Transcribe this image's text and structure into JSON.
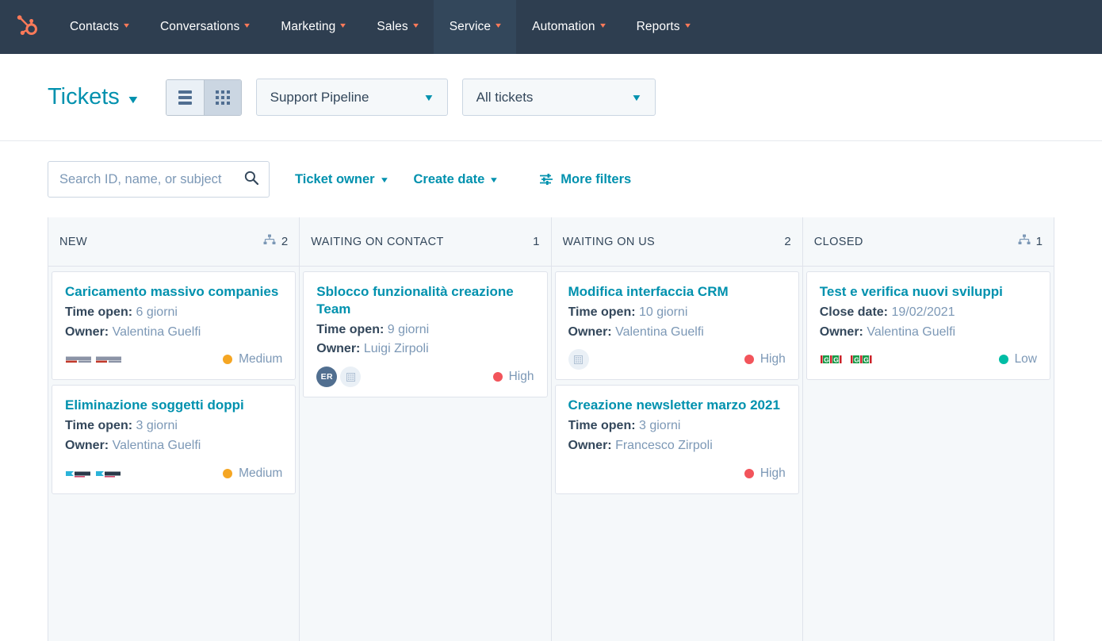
{
  "topnav": {
    "logo_icon": "hubspot-sprocket-logo",
    "items": [
      {
        "label": "Contacts",
        "active": false
      },
      {
        "label": "Conversations",
        "active": false
      },
      {
        "label": "Marketing",
        "active": false
      },
      {
        "label": "Sales",
        "active": false
      },
      {
        "label": "Service",
        "active": true
      },
      {
        "label": "Automation",
        "active": false
      },
      {
        "label": "Reports",
        "active": false
      }
    ]
  },
  "toolbar": {
    "page_title": "Tickets",
    "view_list_icon": "list-view-icon",
    "view_board_icon": "board-view-icon",
    "active_view": "board",
    "pipeline_select": "Support Pipeline",
    "tickets_select": "All tickets"
  },
  "filterbar": {
    "search_placeholder": "Search ID, name, or subject",
    "search_value": "",
    "search_icon": "search-icon",
    "ticket_owner": "Ticket owner",
    "create_date": "Create date",
    "more_filters": "More filters",
    "more_filters_icon": "filter-sliders-icon"
  },
  "colors": {
    "nav_bg": "#2e3e50",
    "nav_active_bg": "#33475b",
    "brand_orange": "#ff7a59",
    "link_teal": "#0091ae",
    "priority_high": "#f2545b",
    "priority_medium": "#f5a623",
    "priority_low": "#00bda5",
    "board_bg": "#f5f8fa",
    "border": "#dfe3eb"
  },
  "board": {
    "columns": [
      {
        "title": "NEW",
        "count": "2",
        "has_workflow_icon": true,
        "workflow_icon": "workflow-icon",
        "cards": [
          {
            "title": "Caricamento massivo companies",
            "meta_label": "Time open:",
            "meta_value": "6 giorni",
            "owner_label": "Owner:",
            "owner_value": "Valentina Guelfi",
            "avatars": [
              {
                "type": "logo",
                "name": "company-logo-avatar"
              },
              {
                "type": "logo",
                "name": "company-logo-avatar"
              }
            ],
            "priority": "Medium",
            "priority_color": "#f5a623"
          },
          {
            "title": "Eliminazione soggetti doppi",
            "meta_label": "Time open:",
            "meta_value": "3 giorni",
            "owner_label": "Owner:",
            "owner_value": "Valentina Guelfi",
            "avatars": [
              {
                "type": "logo2",
                "name": "company-logo-avatar"
              },
              {
                "type": "logo2",
                "name": "company-logo-avatar"
              }
            ],
            "priority": "Medium",
            "priority_color": "#f5a623"
          }
        ]
      },
      {
        "title": "WAITING ON CONTACT",
        "count": "1",
        "has_workflow_icon": false,
        "workflow_icon": "",
        "cards": [
          {
            "title": "Sblocco funzionalità creazione Team",
            "meta_label": "Time open:",
            "meta_value": "9 giorni",
            "owner_label": "Owner:",
            "owner_value": "Luigi Zirpoli",
            "avatars": [
              {
                "type": "initials",
                "name": "contact-avatar",
                "text": "ER"
              },
              {
                "type": "placeholder",
                "name": "company-placeholder-avatar"
              }
            ],
            "priority": "High",
            "priority_color": "#f2545b"
          }
        ]
      },
      {
        "title": "WAITING ON US",
        "count": "2",
        "has_workflow_icon": false,
        "workflow_icon": "",
        "cards": [
          {
            "title": "Modifica interfaccia CRM",
            "meta_label": "Time open:",
            "meta_value": "10 giorni",
            "owner_label": "Owner:",
            "owner_value": "Valentina Guelfi",
            "avatars": [
              {
                "type": "placeholder",
                "name": "company-placeholder-avatar"
              }
            ],
            "priority": "High",
            "priority_color": "#f2545b"
          },
          {
            "title": "Creazione newsletter marzo 2021",
            "meta_label": "Time open:",
            "meta_value": "3 giorni",
            "owner_label": "Owner:",
            "owner_value": "Francesco Zirpoli",
            "avatars": [],
            "priority": "High",
            "priority_color": "#f2545b"
          }
        ]
      },
      {
        "title": "CLOSED",
        "count": "1",
        "has_workflow_icon": true,
        "workflow_icon": "workflow-icon",
        "cards": [
          {
            "title": "Test e verifica nuovi sviluppi",
            "meta_label": "Close date:",
            "meta_value": "19/02/2021",
            "owner_label": "Owner:",
            "owner_value": "Valentina Guelfi",
            "avatars": [
              {
                "type": "logo3",
                "name": "company-logo-avatar"
              },
              {
                "type": "logo3",
                "name": "company-logo-avatar"
              }
            ],
            "priority": "Low",
            "priority_color": "#00bda5"
          }
        ]
      }
    ]
  }
}
